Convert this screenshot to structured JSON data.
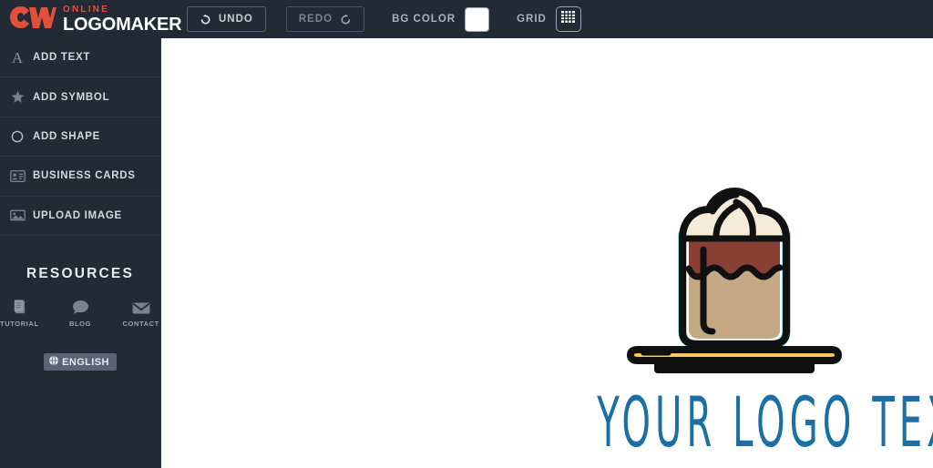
{
  "brand": {
    "line1": "ONLINE",
    "line2": "LOGOMAKER",
    "mark": "cm-monogram-icon",
    "accent_color": "#e2503a"
  },
  "toolbar": {
    "undo_label": "UNDO",
    "undo_icon": "undo-arrow-icon",
    "redo_label": "REDO",
    "redo_icon": "redo-arrow-icon",
    "bgcolor_label": "BG COLOR",
    "bgcolor_value": "#ffffff",
    "grid_label": "GRID",
    "grid_icon": "grid-icon"
  },
  "sidebar": {
    "items": [
      {
        "label": "ADD TEXT",
        "icon": "text-a-icon"
      },
      {
        "label": "ADD SYMBOL",
        "icon": "star-icon"
      },
      {
        "label": "ADD SHAPE",
        "icon": "circle-icon"
      },
      {
        "label": "BUSINESS CARDS",
        "icon": "id-card-icon"
      },
      {
        "label": "UPLOAD IMAGE",
        "icon": "image-icon"
      }
    ],
    "resources": {
      "title": "RESOURCES",
      "links": [
        {
          "label": "TUTORIAL",
          "icon": "book-icon"
        },
        {
          "label": "BLOG",
          "icon": "speech-bubble-icon"
        },
        {
          "label": "CONTACT",
          "icon": "envelope-icon"
        }
      ],
      "language": {
        "label": "ENGLISH",
        "icon": "globe-icon"
      }
    }
  },
  "canvas": {
    "background": "#ffffff",
    "logo": {
      "text": "YOUR LOGO TEXT",
      "text_color": "#1a6fa4",
      "symbol_name": "iced-coffee-glass-on-tray-icon",
      "symbol_colors": {
        "outline": "#111111",
        "whipped_cream": "#f4ecd9",
        "coffee_dark": "#8a4034",
        "latte": "#c4a883",
        "glass_edge": "#2ec4d4",
        "tray_top": "#f5c95c",
        "tray_bottom": "#f0a03c"
      }
    }
  }
}
